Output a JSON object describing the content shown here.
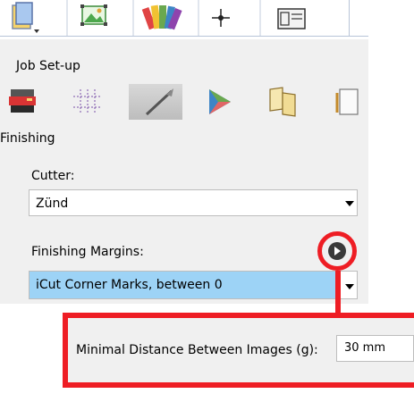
{
  "toolbar": {
    "buttons": [
      {
        "icon": "job-setup-page-icon"
      },
      {
        "icon": "image-layout-icon"
      },
      {
        "icon": "color-swatches-icon"
      },
      {
        "icon": "crosshair-icon"
      },
      {
        "icon": "window-layout-icon"
      }
    ]
  },
  "section": {
    "title": "Job Set-up"
  },
  "icon_tabs": [
    {
      "icon": "printer-media-icon"
    },
    {
      "icon": "grid-dots-icon"
    },
    {
      "icon": "knife-cutter-icon",
      "selected": true
    },
    {
      "icon": "color-gamut-icon"
    },
    {
      "icon": "book-pages-icon"
    },
    {
      "icon": "document-icon"
    }
  ],
  "finishing": {
    "title": "Finishing",
    "cutter_label": "Cutter:",
    "cutter_value": "Zünd",
    "margins_label": "Finishing Margins:",
    "margins_value": "iCut Corner Marks, between 0",
    "min_distance_label": "Minimal Distance Between Images (g):",
    "min_distance_value": "30 mm"
  },
  "colors": {
    "callout": "#ee1d24",
    "selection": "#9dd3f6",
    "panel_bg": "#f0f0f0"
  }
}
